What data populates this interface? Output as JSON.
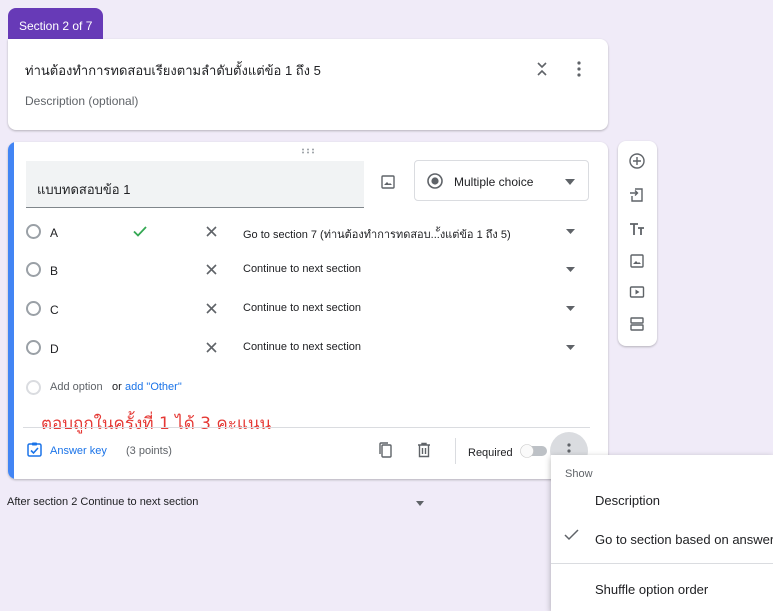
{
  "section_tab": "Section 2 of 7",
  "section": {
    "title": "ท่านต้องทำการทดสอบเรียงตามลำดับตั้งแต่ข้อ 1 ถึง 5",
    "description_placeholder": "Description (optional)"
  },
  "question": {
    "title": "แบบทดสอบข้อ 1",
    "type": "Multiple choice",
    "options": [
      {
        "label": "A",
        "correct": true,
        "goto": "Go to section 7 (ท่านต้องทำการทดสอบ...ั้งแต่ข้อ 1 ถึง 5)"
      },
      {
        "label": "B",
        "correct": false,
        "goto": "Continue to next section"
      },
      {
        "label": "C",
        "correct": false,
        "goto": "Continue to next section"
      },
      {
        "label": "D",
        "correct": false,
        "goto": "Continue to next section"
      }
    ],
    "add_option": "Add option",
    "or_text": "or",
    "add_other": "add \"Other\"",
    "answer_key": "Answer key",
    "points": "(3 points)",
    "required_label": "Required"
  },
  "annotation": "ตอบถูกในครั้งที่ 1 ได้ 3 คะแนน",
  "after_section": "After section 2   Continue to next section",
  "menu": {
    "show_header": "Show",
    "items": [
      {
        "label": "Description",
        "checked": false
      },
      {
        "label": "Go to section based on answer",
        "checked": true
      },
      {
        "label": "Shuffle option order",
        "checked": false
      }
    ]
  },
  "toolbar_icons": [
    "add-question-icon",
    "import-questions-icon",
    "add-title-icon",
    "add-image-icon",
    "add-video-icon",
    "add-section-icon"
  ],
  "colors": {
    "theme": "#673ab7",
    "accent_bar": "#4285f4",
    "link": "#1a73e8",
    "check": "#34a853",
    "annotation": "#e53935",
    "background": "#f0ebf8"
  }
}
